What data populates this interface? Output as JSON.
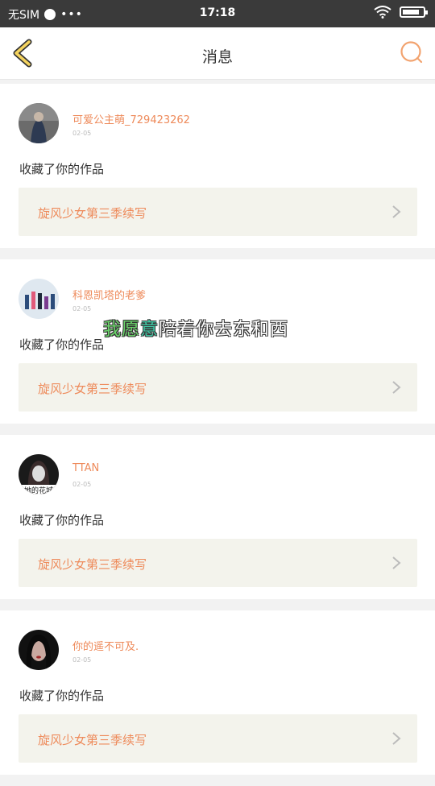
{
  "status_bar": {
    "carrier": "无SIM",
    "dots": "•••",
    "time": "17:18"
  },
  "header": {
    "title": "消息"
  },
  "messages": [
    {
      "name": "可爱公主萌_729423262",
      "date": "02-05",
      "action": "收藏了你的作品",
      "work_title": "旋风少女第三季续写",
      "avatar_colors": [
        "#6b6b6b",
        "#2d3a52",
        "#c7b7a8"
      ]
    },
    {
      "name": "科恩凯塔的老爹",
      "date": "02-05",
      "action": "收藏了你的作品",
      "work_title": "旋风少女第三季续写",
      "avatar_colors": [
        "#dfe8f0",
        "#2b4c7b",
        "#e05a7a"
      ]
    },
    {
      "name": "TTAN",
      "date": "02-05",
      "action": "收藏了你的作品",
      "work_title": "旋风少女第三季续写",
      "avatar_colors": [
        "#1a1a1a",
        "#3a2c2c",
        "#ddd"
      ],
      "avatar_caption": "她的花城"
    },
    {
      "name": "你的遥不可及.",
      "date": "02-05",
      "action": "收藏了你的作品",
      "work_title": "旋风少女第三季续写",
      "avatar_colors": [
        "#111",
        "#c9a9a0",
        "#a02a2a"
      ]
    }
  ],
  "overlay": {
    "part1": "我",
    "part2": "愿",
    "part3": "意",
    "part4": "陪着你去东和西"
  },
  "colors": {
    "accent": "#ee8a5a",
    "status_bg": "#3a3a3a",
    "work_bg": "#f3f3ec"
  }
}
